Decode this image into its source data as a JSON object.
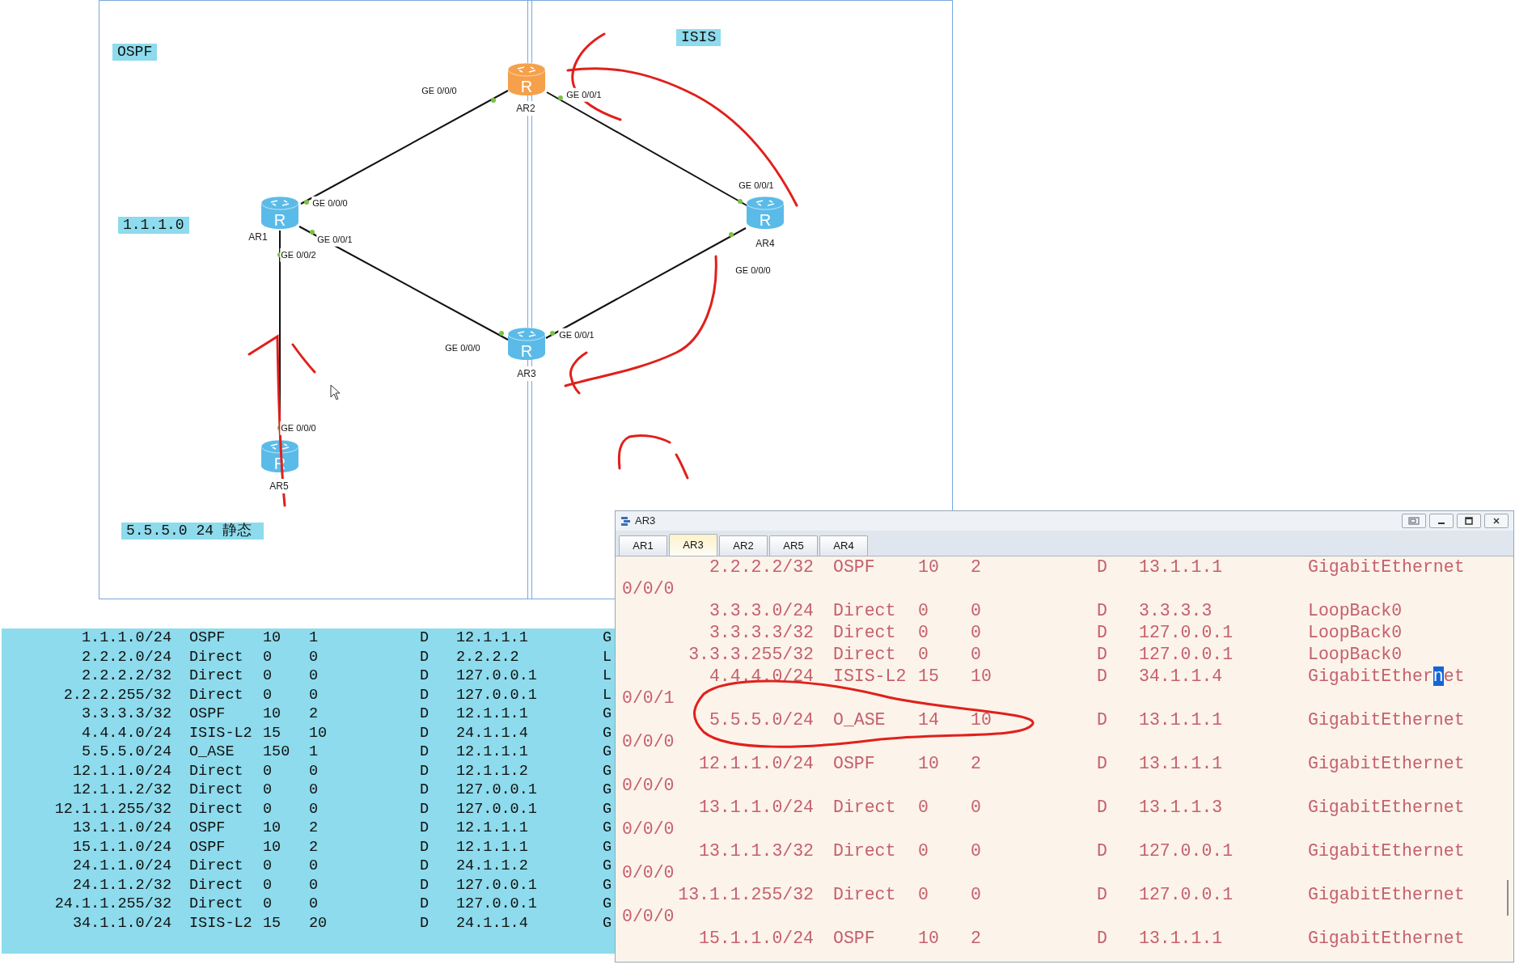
{
  "diagram": {
    "labels": [
      {
        "text": "OSPF"
      },
      {
        "text": "ISIS"
      },
      {
        "text": "1.1.1.0"
      },
      {
        "text": "5.5.5.0 24 静态"
      }
    ],
    "routers": [
      {
        "name": "AR2",
        "glyph": "R",
        "color": "#f5a04a"
      },
      {
        "name": "AR1",
        "glyph": "R",
        "color": "#5bbbe8"
      },
      {
        "name": "AR4",
        "glyph": "R",
        "color": "#5bbbe8"
      },
      {
        "name": "AR3",
        "glyph": "R",
        "color": "#5bbbe8"
      },
      {
        "name": "AR5",
        "glyph": "R",
        "color": "#5bbbe8"
      }
    ],
    "port_labels": [
      "GE 0/0/0",
      "GE 0/0/1",
      "GE 0/0/0",
      "GE 0/0/1",
      "GE 0/0/2",
      "GE 0/0/1",
      "GE 0/0/0",
      "GE 0/0/0",
      "GE 0/0/1",
      "GE 0/0/0"
    ]
  },
  "route_table": {
    "rows": [
      [
        "1.1.1.0/24",
        "OSPF",
        "10",
        "1",
        "D",
        "12.1.1.1",
        "G"
      ],
      [
        "2.2.2.0/24",
        "Direct",
        "0",
        "0",
        "D",
        "2.2.2.2",
        "L"
      ],
      [
        "2.2.2.2/32",
        "Direct",
        "0",
        "0",
        "D",
        "127.0.0.1",
        "L"
      ],
      [
        "2.2.2.255/32",
        "Direct",
        "0",
        "0",
        "D",
        "127.0.0.1",
        "L"
      ],
      [
        "3.3.3.3/32",
        "OSPF",
        "10",
        "2",
        "D",
        "12.1.1.1",
        "G"
      ],
      [
        "4.4.4.0/24",
        "ISIS-L2",
        "15",
        "10",
        "D",
        "24.1.1.4",
        "G"
      ],
      [
        "5.5.5.0/24",
        "O_ASE",
        "150",
        "1",
        "D",
        "12.1.1.1",
        "G"
      ],
      [
        "12.1.1.0/24",
        "Direct",
        "0",
        "0",
        "D",
        "12.1.1.2",
        "G"
      ],
      [
        "12.1.1.2/32",
        "Direct",
        "0",
        "0",
        "D",
        "127.0.0.1",
        "G"
      ],
      [
        "12.1.1.255/32",
        "Direct",
        "0",
        "0",
        "D",
        "127.0.0.1",
        "G"
      ],
      [
        "13.1.1.0/24",
        "OSPF",
        "10",
        "2",
        "D",
        "12.1.1.1",
        "G"
      ],
      [
        "15.1.1.0/24",
        "OSPF",
        "10",
        "2",
        "D",
        "12.1.1.1",
        "G"
      ],
      [
        "24.1.1.0/24",
        "Direct",
        "0",
        "0",
        "D",
        "24.1.1.2",
        "G"
      ],
      [
        "24.1.1.2/32",
        "Direct",
        "0",
        "0",
        "D",
        "127.0.0.1",
        "G"
      ],
      [
        "24.1.1.255/32",
        "Direct",
        "0",
        "0",
        "D",
        "127.0.0.1",
        "G"
      ],
      [
        "34.1.1.0/24",
        "ISIS-L2",
        "15",
        "20",
        "D",
        "24.1.1.4",
        "G"
      ]
    ]
  },
  "terminal": {
    "title": "AR3",
    "tabs": [
      {
        "label": "AR1",
        "selected": false
      },
      {
        "label": "AR3",
        "selected": true
      },
      {
        "label": "AR2",
        "selected": false
      },
      {
        "label": "AR5",
        "selected": false
      },
      {
        "label": "AR4",
        "selected": false
      }
    ],
    "lines": [
      {
        "kind": "route",
        "cells": [
          "2.2.2.2/32",
          "OSPF",
          "10",
          "2",
          "D",
          "13.1.1.1",
          "GigabitEthernet"
        ]
      },
      {
        "kind": "wrap",
        "text": "0/0/0"
      },
      {
        "kind": "route",
        "cells": [
          "3.3.3.0/24",
          "Direct",
          "0",
          "0",
          "D",
          "3.3.3.3",
          "LoopBack0"
        ]
      },
      {
        "kind": "route",
        "cells": [
          "3.3.3.3/32",
          "Direct",
          "0",
          "0",
          "D",
          "127.0.0.1",
          "LoopBack0"
        ]
      },
      {
        "kind": "route",
        "cells": [
          "3.3.3.255/32",
          "Direct",
          "0",
          "0",
          "D",
          "127.0.0.1",
          "LoopBack0"
        ]
      },
      {
        "kind": "route",
        "cells": [
          "4.4.4.0/24",
          "ISIS-L2",
          "15",
          "10",
          "D",
          "34.1.1.4"
        ],
        "cursor_parts": [
          "GigabitEther",
          "n",
          "et"
        ]
      },
      {
        "kind": "wrap",
        "text": "0/0/1"
      },
      {
        "kind": "route",
        "cells": [
          "5.5.5.0/24",
          "O_ASE",
          "14",
          "10",
          "D",
          "13.1.1.1",
          "GigabitEthernet"
        ]
      },
      {
        "kind": "wrap",
        "text": "0/0/0"
      },
      {
        "kind": "route",
        "cells": [
          "12.1.1.0/24",
          "OSPF",
          "10",
          "2",
          "D",
          "13.1.1.1",
          "GigabitEthernet"
        ]
      },
      {
        "kind": "wrap",
        "text": "0/0/0"
      },
      {
        "kind": "route",
        "cells": [
          "13.1.1.0/24",
          "Direct",
          "0",
          "0",
          "D",
          "13.1.1.3",
          "GigabitEthernet"
        ]
      },
      {
        "kind": "wrap",
        "text": "0/0/0"
      },
      {
        "kind": "route",
        "cells": [
          "13.1.1.3/32",
          "Direct",
          "0",
          "0",
          "D",
          "127.0.0.1",
          "GigabitEthernet"
        ]
      },
      {
        "kind": "wrap",
        "text": "0/0/0"
      },
      {
        "kind": "route",
        "cells": [
          "13.1.1.255/32",
          "Direct",
          "0",
          "0",
          "D",
          "127.0.0.1",
          "GigabitEthernet"
        ]
      },
      {
        "kind": "wrap",
        "text": "0/0/0"
      },
      {
        "kind": "route",
        "cells": [
          "15.1.1.0/24",
          "OSPF",
          "10",
          "2",
          "D",
          "13.1.1.1",
          "GigabitEthernet"
        ]
      }
    ]
  }
}
